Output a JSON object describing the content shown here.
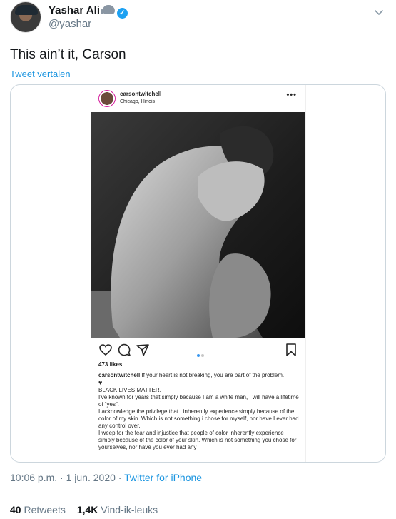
{
  "author": {
    "display_name": "Yashar Ali",
    "handle": "@yashar",
    "badge_icon": "elephant-icon",
    "verified_icon": "verified-check-icon"
  },
  "tweet": {
    "text": "This ain’t it, Carson",
    "translate_label": "Tweet vertalen",
    "time": "10:06 p.m.",
    "separator1": " · ",
    "date": "1 jun. 2020",
    "separator2": " · ",
    "source": "Twitter for iPhone"
  },
  "stats": {
    "retweets_count": "40",
    "retweets_label": "Retweets",
    "likes_count": "1,4K",
    "likes_label": "Vind-ik-leuks"
  },
  "instagram_post": {
    "username": "carsontwitchell",
    "location": "Chicago, Illinois",
    "more_icon": "•••",
    "likes": "473 likes",
    "caption_user": "carsontwitchell",
    "caption_lines": [
      " If your heart is not breaking, you are part of the problem.",
      "♥",
      "BLACK LIVES MATTER.",
      "I've known for years that simply because I am a white man, I will have a lifetime of “yes”.",
      "I acknowledge the privilege that I inherently experience simply because of the color of my skin. Which is not something i chose for myself, nor have I ever had any control over.",
      "I weep for the fear and injustice that people of color inherently experience simply because of the color of your skin. Which is not something you chose for yourselves, nor have you ever had any"
    ]
  },
  "colors": {
    "accent": "#1da1f2",
    "link": "#1b95e0",
    "text_primary": "#14171a",
    "text_secondary": "#657786"
  }
}
